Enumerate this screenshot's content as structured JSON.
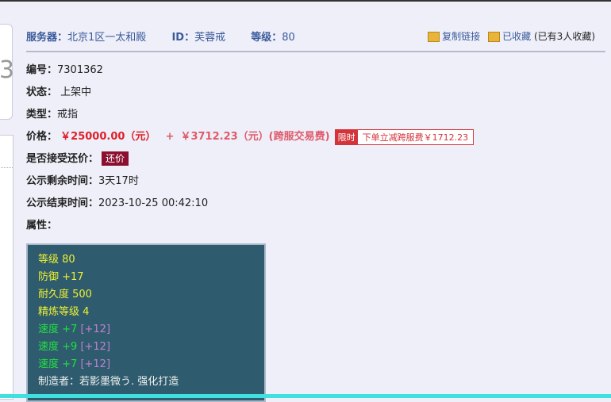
{
  "header": {
    "server_label": "服务器：",
    "server": "北京1区一太和殿",
    "id_label": "ID：",
    "id": "芙蓉戒",
    "level_label": "等级：",
    "level": "80"
  },
  "actions": {
    "copy_link": "复制链接",
    "favorited": "已收藏",
    "fav_count": "(已有3人收藏)"
  },
  "left_card_glyph": "3",
  "details": {
    "code_label": "编号：",
    "code": "7301362",
    "status_label": "状态：",
    "status": "上架中",
    "type_label": "类型：",
    "type": "戒指",
    "price_label": "价格：",
    "price": "￥25000.00（元）",
    "plus": "+",
    "fee": "￥3712.23（元）(跨服交易费)",
    "badge_tag": "限时",
    "badge_text": "下单立减跨服费￥1712.23",
    "bargain_label": "是否接受还价：",
    "bargain_button": "还价",
    "remaining_label": "公示剩余时间：",
    "remaining": "3天17时",
    "end_label": "公示结束时间：",
    "end": "2023-10-25 00:42:10",
    "attr_label": "属性："
  },
  "attributes": [
    {
      "text": "等级 80",
      "color": "yellow"
    },
    {
      "text": "防御 +17",
      "color": "yellow"
    },
    {
      "text": "耐久度 500",
      "color": "yellow"
    },
    {
      "text": "精炼等级 4",
      "color": "yellow"
    },
    {
      "text": "速度 +7",
      "extra": "[+12]",
      "color": "green"
    },
    {
      "text": "速度 +9",
      "extra": "[+12]",
      "color": "green"
    },
    {
      "text": "速度 +7",
      "extra": "[+12]",
      "color": "green"
    },
    {
      "text": "制造者：若影墨微う. 强化打造",
      "color": "white"
    }
  ]
}
